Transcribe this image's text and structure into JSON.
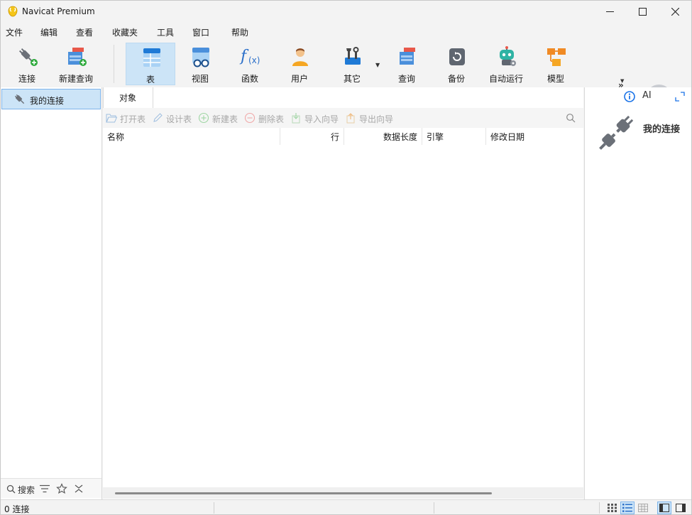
{
  "window": {
    "title": "Navicat Premium"
  },
  "menu": [
    "文件",
    "编辑",
    "查看",
    "收藏夹",
    "工具",
    "窗口",
    "帮助"
  ],
  "toolbar": {
    "connect": "连接",
    "new_query": "新建查询",
    "table": "表",
    "view": "视图",
    "function": "函数",
    "user": "用户",
    "other": "其它",
    "query": "查询",
    "backup": "备份",
    "automation": "自动运行",
    "model": "模型",
    "more": "»"
  },
  "left": {
    "connection": "我的连接",
    "search_label": "搜索"
  },
  "center": {
    "tab": "对象",
    "actions": {
      "open_table": "打开表",
      "design_table": "设计表",
      "new_table": "新建表",
      "delete_table": "删除表",
      "import_wizard": "导入向导",
      "export_wizard": "导出向导"
    },
    "columns": [
      "名称",
      "行",
      "数据长度",
      "引擎",
      "修改日期"
    ]
  },
  "right": {
    "ai_label": "AI",
    "title": "我的连接"
  },
  "status": {
    "text": "0 连接"
  },
  "colors": {
    "accent": "#cce4f7",
    "accent_border": "#7eb4ea",
    "blue": "#1a73e8"
  }
}
